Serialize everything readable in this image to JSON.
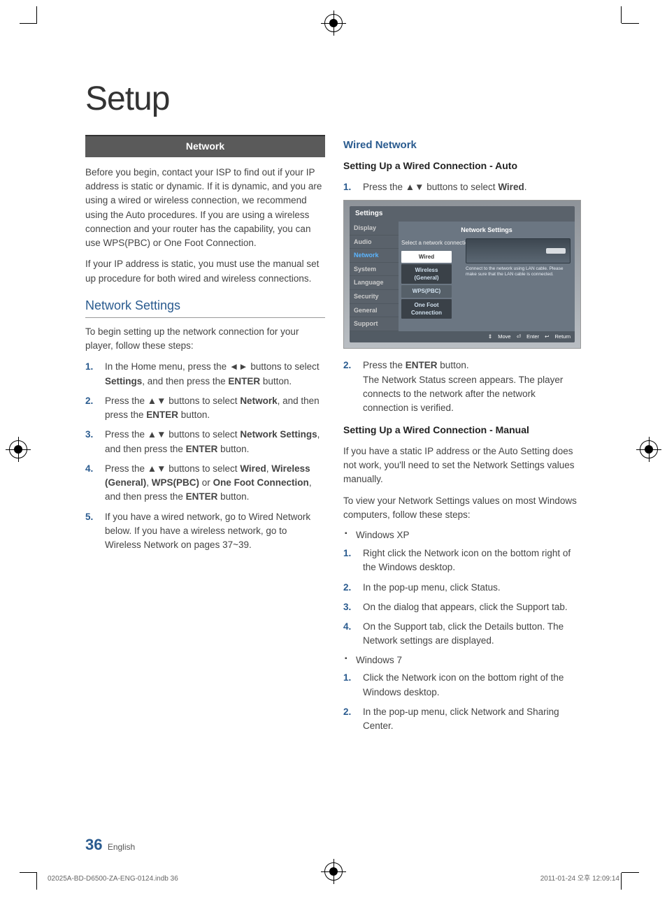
{
  "page": {
    "title": "Setup",
    "section_bar": "Network",
    "intro1": "Before you begin, contact your ISP to find out if your IP address is static or dynamic. If it is dynamic, and you are using a wired or wireless connection, we recommend using the Auto procedures. If you are using a wireless connection and your router has the capability, you can use WPS(PBC) or One Foot Connection.",
    "intro2": "If your IP address is static, you must use the manual set up procedure for both wired and wireless connections.",
    "h2_net_settings": "Network Settings",
    "net_settings_intro": "To begin setting up the network connection for your player, follow these steps:",
    "steps_left": [
      {
        "pre": "In the Home menu, press the ◄► buttons to select ",
        "b1": "Settings",
        "mid": ", and then press the ",
        "b2": "ENTER",
        "post": " button."
      },
      {
        "pre": "Press the ▲▼ buttons to select ",
        "b1": "Network",
        "mid": ", and then press the ",
        "b2": "ENTER",
        "post": " button."
      },
      {
        "pre": "Press the ▲▼ buttons to select ",
        "b1": "Network Settings",
        "mid": ", and then press the ",
        "b2": "ENTER",
        "post": " button."
      },
      {
        "pre": "Press the ▲▼ buttons to select ",
        "b1": "Wired",
        "mid": ", ",
        "b2": "Wireless (General)",
        "mid2": ", ",
        "b3": "WPS(PBC)",
        "mid3": " or ",
        "b4": "One Foot Connection",
        "mid4": ", and then press the ",
        "b5": "ENTER",
        "post": " button."
      },
      {
        "text": "If you have a wired network, go to Wired Network below. If you have a wireless network, go to Wireless Network on pages 37~39."
      }
    ],
    "right_h": "Wired Network",
    "right_sub1": "Setting Up a Wired Connection - Auto",
    "right_step1_pre": "Press the ▲▼ buttons to select ",
    "right_step1_b": "Wired",
    "right_step1_post": ".",
    "shot": {
      "top": "Settings",
      "side": [
        "Display",
        "Audio",
        "Network",
        "System",
        "Language",
        "Security",
        "General",
        "Support"
      ],
      "header": "Network Settings",
      "sub": "Select a network connection type.",
      "opts": [
        "Wired",
        "Wireless (General)",
        "WPS(PBC)",
        "One Foot Connection"
      ],
      "note": "Connect to the network using LAN cable. Please make sure that the LAN cable is connected.",
      "footer_move": "Move",
      "footer_enter": "Enter",
      "footer_return": "Return"
    },
    "right_step2_pre": "Press the ",
    "right_step2_b": "ENTER",
    "right_step2_post": " button.",
    "right_step2_text": "The Network Status screen appears. The player connects to the network after the network connection is verified.",
    "right_sub2": "Setting Up a Wired Connection - Manual",
    "right_manual_p1": "If you have a static IP address or the Auto Setting does not work, you'll need to set the Network Settings values manually.",
    "right_manual_p2": "To view your Network Settings values on most Windows computers, follow these steps:",
    "bullet_xp": "Windows XP",
    "xp_steps": [
      "Right click the Network icon on the bottom right of the Windows desktop.",
      "In the pop-up menu, click Status.",
      "On the dialog that appears, click the Support tab.",
      "On the Support tab, click the Details button. The Network settings are displayed."
    ],
    "bullet_7": "Windows 7",
    "w7_steps": [
      "Click the Network icon on the bottom right of the Windows desktop.",
      "In the pop-up menu, click Network and Sharing Center."
    ],
    "page_num": "36",
    "page_lang": "English",
    "footer_left": "02025A-BD-D6500-ZA-ENG-0124.indb   36",
    "footer_right": "2011-01-24   오후 12:09:14"
  }
}
